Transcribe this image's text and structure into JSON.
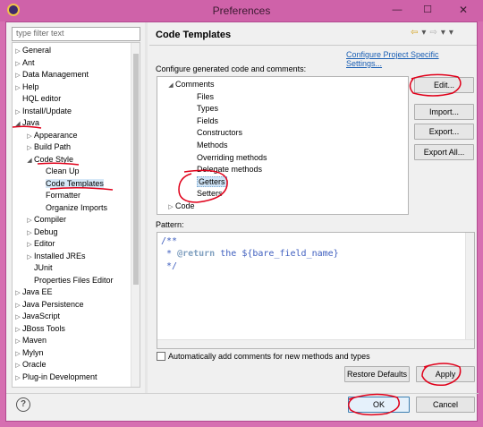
{
  "window": {
    "title": "Preferences",
    "minimize": "—",
    "maximize": "☐",
    "close": "✕"
  },
  "filter": {
    "placeholder": "type filter text"
  },
  "tree": [
    {
      "label": "General",
      "arrow": "▷",
      "indent": 0
    },
    {
      "label": "Ant",
      "arrow": "▷",
      "indent": 0
    },
    {
      "label": "Data Management",
      "arrow": "▷",
      "indent": 0
    },
    {
      "label": "Help",
      "arrow": "▷",
      "indent": 0
    },
    {
      "label": "HQL editor",
      "arrow": "",
      "indent": 0
    },
    {
      "label": "Install/Update",
      "arrow": "▷",
      "indent": 0
    },
    {
      "label": "Java",
      "arrow": "◢",
      "indent": 0
    },
    {
      "label": "Appearance",
      "arrow": "▷",
      "indent": 1
    },
    {
      "label": "Build Path",
      "arrow": "▷",
      "indent": 1
    },
    {
      "label": "Code Style",
      "arrow": "◢",
      "indent": 1
    },
    {
      "label": "Clean Up",
      "arrow": "",
      "indent": 2
    },
    {
      "label": "Code Templates",
      "arrow": "",
      "indent": 2,
      "selected": true
    },
    {
      "label": "Formatter",
      "arrow": "",
      "indent": 2
    },
    {
      "label": "Organize Imports",
      "arrow": "",
      "indent": 2
    },
    {
      "label": "Compiler",
      "arrow": "▷",
      "indent": 1
    },
    {
      "label": "Debug",
      "arrow": "▷",
      "indent": 1
    },
    {
      "label": "Editor",
      "arrow": "▷",
      "indent": 1
    },
    {
      "label": "Installed JREs",
      "arrow": "▷",
      "indent": 1
    },
    {
      "label": "JUnit",
      "arrow": "",
      "indent": 1
    },
    {
      "label": "Properties Files Editor",
      "arrow": "",
      "indent": 1
    },
    {
      "label": "Java EE",
      "arrow": "▷",
      "indent": 0
    },
    {
      "label": "Java Persistence",
      "arrow": "▷",
      "indent": 0
    },
    {
      "label": "JavaScript",
      "arrow": "▷",
      "indent": 0
    },
    {
      "label": "JBoss Tools",
      "arrow": "▷",
      "indent": 0
    },
    {
      "label": "Maven",
      "arrow": "▷",
      "indent": 0
    },
    {
      "label": "Mylyn",
      "arrow": "▷",
      "indent": 0
    },
    {
      "label": "Oracle",
      "arrow": "▷",
      "indent": 0
    },
    {
      "label": "Plug-in Development",
      "arrow": "▷",
      "indent": 0
    }
  ],
  "page": {
    "title": "Code Templates",
    "nav": {
      "back": "⇦",
      "back_menu": "▾",
      "forward": "⇨",
      "forward_menu": "▾",
      "view_menu": "▾"
    },
    "project_link": "Configure Project Specific Settings...",
    "configure_label": "Configure generated code and comments:"
  },
  "templates": [
    {
      "label": "Comments",
      "arrow": "◢",
      "indent": 0
    },
    {
      "label": "Files",
      "arrow": "",
      "indent": 1
    },
    {
      "label": "Types",
      "arrow": "",
      "indent": 1
    },
    {
      "label": "Fields",
      "arrow": "",
      "indent": 1
    },
    {
      "label": "Constructors",
      "arrow": "",
      "indent": 1
    },
    {
      "label": "Methods",
      "arrow": "",
      "indent": 1
    },
    {
      "label": "Overriding methods",
      "arrow": "",
      "indent": 1
    },
    {
      "label": "Delegate methods",
      "arrow": "",
      "indent": 1
    },
    {
      "label": "Getters",
      "arrow": "",
      "indent": 1,
      "selected": true
    },
    {
      "label": "Setters",
      "arrow": "",
      "indent": 1
    },
    {
      "label": "Code",
      "arrow": "▷",
      "indent": 0
    }
  ],
  "buttons": {
    "edit": "Edit...",
    "import": "Import...",
    "export": "Export...",
    "export_all": "Export All...",
    "restore_defaults": "Restore Defaults",
    "apply": "Apply",
    "ok": "OK",
    "cancel": "Cancel",
    "help": "?"
  },
  "pattern": {
    "label": "Pattern:",
    "line1": "/**",
    "line2_prefix": " * ",
    "line2_tag": "@return",
    "line2_rest": " the ${bare_field_name}",
    "line3": " */"
  },
  "auto_comments": {
    "label": "Automatically add comments for new methods and types",
    "checked": false
  }
}
